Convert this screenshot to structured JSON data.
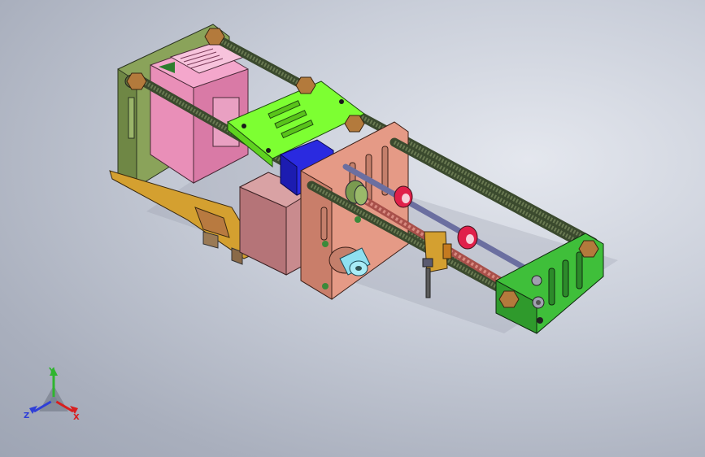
{
  "viewport": {
    "background_top": "#dfe3ea",
    "background_bottom": "#a3aab8"
  },
  "model": {
    "part_colors": {
      "rear_plate": "#8aa35a",
      "controller_board": "#e98fb8",
      "carriage_plate": "#7dff32",
      "stepper_driver": "#2a2ae0",
      "motor": "#c98b8e",
      "front_plate": "#e59a86",
      "end_plate": "#3fbf3a",
      "lead_screw": "#c26a62",
      "guide_rod": "#4b5a3c",
      "bearing_red": "#e0204a",
      "bracket_orange": "#d4a030",
      "coupler": "#8fe0f0",
      "hex_nut": "#b37a3c"
    }
  },
  "triad": {
    "x_label": "X",
    "y_label": "Y",
    "z_label": "Z",
    "x_color": "#d81e1e",
    "y_color": "#2fb52f",
    "z_color": "#2f3fd8"
  }
}
